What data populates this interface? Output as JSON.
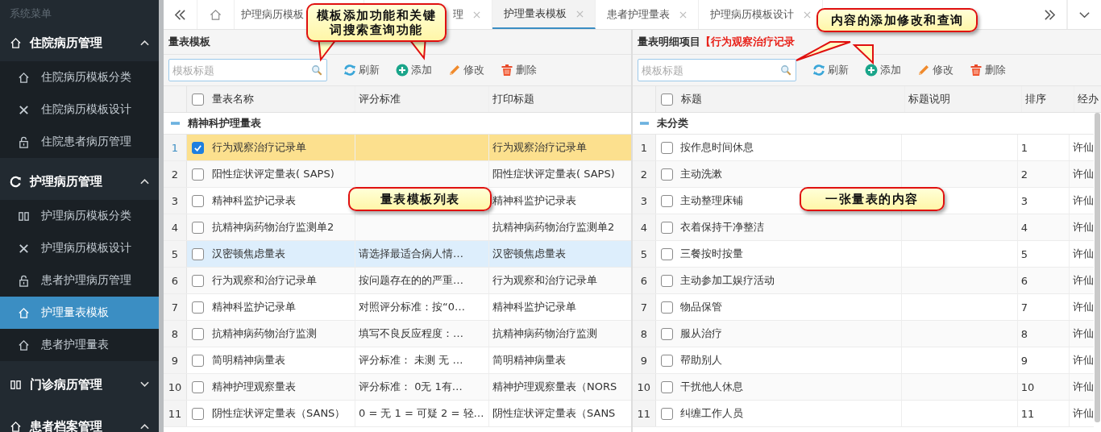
{
  "sidebar": {
    "title": "系统菜单",
    "groups": [
      {
        "label": "住院病历管理",
        "kind": "home",
        "expanded": true,
        "items": [
          {
            "label": "住院病历模板分类",
            "kind": "home",
            "selected": false
          },
          {
            "label": "住院病历模板设计",
            "kind": "tools",
            "selected": false
          },
          {
            "label": "住院患者病历管理",
            "kind": "lock",
            "selected": false
          }
        ]
      },
      {
        "label": "护理病历管理",
        "kind": "refresh",
        "expanded": true,
        "items": [
          {
            "label": "护理病历模板分类",
            "kind": "book",
            "selected": false
          },
          {
            "label": "护理病历模板设计",
            "kind": "tools",
            "selected": false
          },
          {
            "label": "患者护理病历管理",
            "kind": "lock",
            "selected": false
          },
          {
            "label": "护理量表模板",
            "kind": "home",
            "selected": true
          },
          {
            "label": "患者护理量表",
            "kind": "home",
            "selected": false
          }
        ]
      },
      {
        "label": "门诊病历管理",
        "kind": "book",
        "expanded": false
      },
      {
        "label": "患者档案管理",
        "kind": "home",
        "expanded": true
      }
    ]
  },
  "tabs": [
    {
      "label": "护理病历模板",
      "selected": false
    },
    {
      "label": "理",
      "closable": true,
      "selected": false
    },
    {
      "label": "护理量表模板",
      "closable": true,
      "selected": true
    },
    {
      "label": "患者护理量表",
      "closable": true,
      "selected": false
    },
    {
      "label": "护理病历模板设计",
      "closable": true,
      "selected": false
    }
  ],
  "left_panel": {
    "title": "量表模板",
    "search": {
      "placeholder": "模板标题"
    },
    "toolbar": [
      {
        "kind": "refresh",
        "label": "刷新"
      },
      {
        "kind": "add",
        "label": "添加"
      },
      {
        "kind": "edit",
        "label": "修改"
      },
      {
        "kind": "delete",
        "label": "删除"
      }
    ],
    "columns": [
      "量表名称",
      "评分标准",
      "打印标题"
    ],
    "header_checked": false,
    "group": {
      "label": "精神科护理量表",
      "expanded": true
    },
    "rows": [
      {
        "number": "1",
        "name": "行为观察治疗记录单",
        "print_title": "行为观察治疗记录单",
        "checked": true,
        "selected": true,
        "hovered": false
      },
      {
        "number": "2",
        "name": "阳性症状评定量表( SAPS)",
        "print_title": "阳性症状评定量表( SAPS)",
        "checked": false,
        "selected": false,
        "hovered": false
      },
      {
        "number": "3",
        "name": "精神科监护记录表",
        "print_title": "精神科监护记录表",
        "checked": false,
        "selected": false,
        "hovered": false
      },
      {
        "number": "4",
        "name": "抗精神病药物治疗监测单2",
        "print_title": "抗精神病药物治疗监测单2",
        "checked": false,
        "selected": false,
        "hovered": false
      },
      {
        "number": "5",
        "name": "汉密顿焦虑量表",
        "criteria": "请选择最适合病人情…",
        "print_title": "汉密顿焦虑量表",
        "checked": false,
        "selected": false,
        "hovered": true
      },
      {
        "number": "6",
        "name": "行为观察和治疗记录单",
        "criteria": "按问题存在的的严重…",
        "print_title": "行为观察和治疗记录单",
        "checked": false,
        "selected": false,
        "hovered": false
      },
      {
        "number": "7",
        "name": "精神科监护记录单",
        "criteria": "对照评分标准：按“0…",
        "print_title": "精神科监护记录单",
        "checked": false,
        "selected": false,
        "hovered": false
      },
      {
        "number": "8",
        "name": "抗精神病药物治疗监测",
        "criteria": "填写不良反应程度：…",
        "print_title": "抗精神病药物治疗监测",
        "checked": false,
        "selected": false,
        "hovered": false
      },
      {
        "number": "9",
        "name": "简明精神病量表",
        "criteria": "评分标准： 未测 无 …",
        "print_title": "简明精神病量表",
        "checked": false,
        "selected": false,
        "hovered": false
      },
      {
        "number": "10",
        "name": "精神护理观察量表",
        "criteria": "评分标准： 0无 1有…",
        "print_title": "精神护理观察量表（NORS",
        "checked": false,
        "selected": false,
        "hovered": false
      },
      {
        "number": "11",
        "name": "阴性症状评定量表（SANS）",
        "criteria": "0 = 无 1 = 可疑 2 = 轻…",
        "print_title": "阴性症状评定量表（SANS",
        "checked": false,
        "selected": false,
        "hovered": false
      }
    ]
  },
  "right_panel": {
    "title": "量表明细项目",
    "title_highlight": "【行为观察治疗记录",
    "search": {
      "placeholder": "模板标题"
    },
    "toolbar": [
      {
        "kind": "refresh",
        "label": "刷新"
      },
      {
        "kind": "add",
        "label": "添加"
      },
      {
        "kind": "edit",
        "label": "修改"
      },
      {
        "kind": "delete",
        "label": "删除"
      }
    ],
    "columns": [
      "标题",
      "标题说明",
      "排序",
      "经办"
    ],
    "header_checked": false,
    "group": {
      "label": "未分类",
      "expanded": true
    },
    "rows": [
      {
        "number": "1",
        "title": "按作息时间休息",
        "sort": "1",
        "handler": "许仙",
        "checked": false
      },
      {
        "number": "2",
        "title": "主动洗漱",
        "sort": "2",
        "handler": "许仙",
        "checked": false
      },
      {
        "number": "3",
        "title": "主动整理床铺",
        "sort": "3",
        "handler": "许仙",
        "checked": false
      },
      {
        "number": "4",
        "title": "衣着保持干净整洁",
        "sort": "4",
        "handler": "许仙",
        "checked": false
      },
      {
        "number": "5",
        "title": "三餐按时按量",
        "sort": "5",
        "handler": "许仙",
        "checked": false
      },
      {
        "number": "6",
        "title": "主动参加工娱疗活动",
        "sort": "6",
        "handler": "许仙",
        "checked": false
      },
      {
        "number": "7",
        "title": "物品保管",
        "sort": "7",
        "handler": "许仙",
        "checked": false
      },
      {
        "number": "8",
        "title": "服从治疗",
        "sort": "8",
        "handler": "许仙",
        "checked": false
      },
      {
        "number": "9",
        "title": "帮助别人",
        "sort": "9",
        "handler": "许仙",
        "checked": false
      },
      {
        "number": "10",
        "title": "干扰他人休息",
        "sort": "10",
        "handler": "许仙",
        "checked": false
      },
      {
        "number": "11",
        "title": "纠缠工作人员",
        "sort": "11",
        "handler": "许仙",
        "checked": false
      }
    ]
  },
  "callouts": [
    {
      "text": "模板添加功能和关键词搜索查询功能"
    },
    {
      "text": "内容的添加修改和查询"
    },
    {
      "text": "量表模板列表"
    },
    {
      "text": "一张量表的内容"
    }
  ]
}
